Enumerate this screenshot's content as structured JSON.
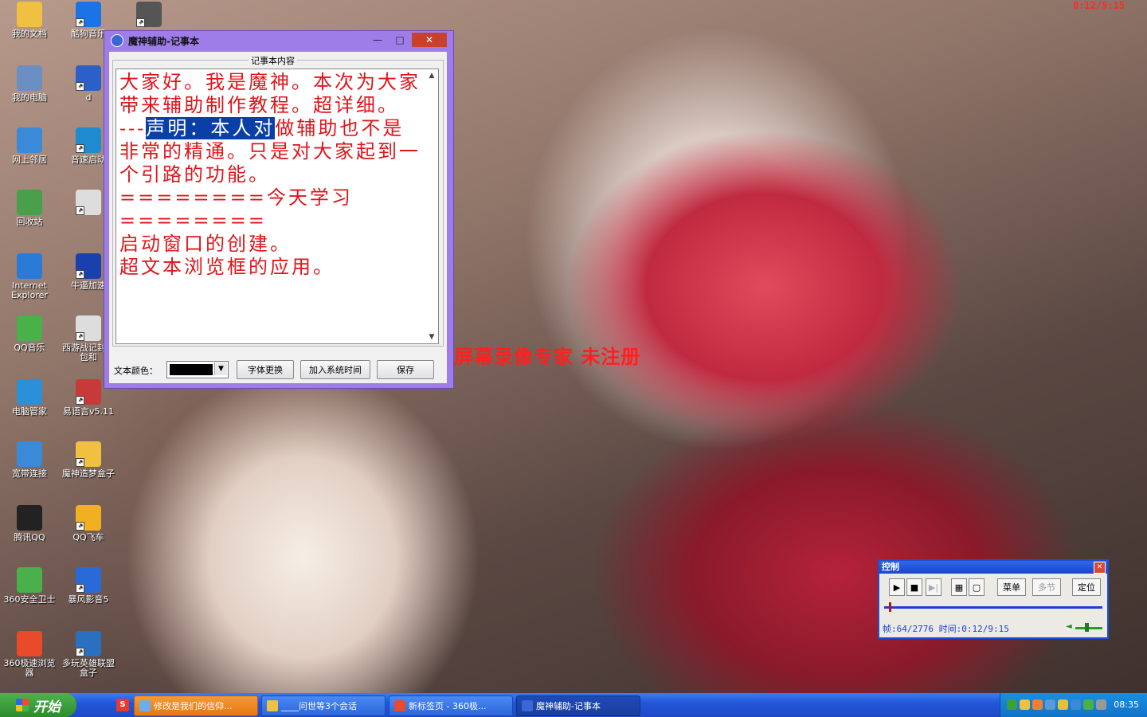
{
  "recorder_timer": "0:12/9:15",
  "desktop_icons": [
    {
      "label": "我的文档",
      "icon": "folder-documents-icon",
      "color": "#f0c040"
    },
    {
      "label": "酷狗音乐",
      "icon": "kugou-music-icon",
      "color": "#1a74e8"
    },
    {
      "label": "",
      "icon": "video-camera-icon",
      "color": "#555555"
    },
    {
      "label": "我的电脑",
      "icon": "my-computer-icon",
      "color": "#6a8fc0"
    },
    {
      "label": "d",
      "icon": "app-shortcut-icon",
      "color": "#2a60c8"
    },
    {
      "label": "网上邻居",
      "icon": "network-places-icon",
      "color": "#3a8ad8"
    },
    {
      "label": "音速启动",
      "icon": "quick-launch-icon",
      "color": "#1e8ad0"
    },
    {
      "label": "回收站",
      "icon": "recycle-bin-icon",
      "color": "#4aa04a"
    },
    {
      "label": "",
      "icon": "text-file-icon",
      "color": "#dddddd"
    },
    {
      "label": "Internet Explorer",
      "icon": "internet-explorer-icon",
      "color": "#2a7ad8"
    },
    {
      "label": "牛逼加速",
      "icon": "accelerator-icon",
      "color": "#1a40b0"
    },
    {
      "label": "QQ音乐",
      "icon": "qq-music-icon",
      "color": "#4ab04a"
    },
    {
      "label": "西游战记封背包和",
      "icon": "text-file-icon",
      "color": "#dddddd"
    },
    {
      "label": "电脑管家",
      "icon": "pc-manager-icon",
      "color": "#2a90d8"
    },
    {
      "label": "易语言v5.11",
      "icon": "e-language-icon",
      "color": "#c83a3a"
    },
    {
      "label": "宽带连接",
      "icon": "broadband-connection-icon",
      "color": "#3a8ad8"
    },
    {
      "label": "魔神造梦盒子",
      "icon": "folder-icon",
      "color": "#f0c040"
    },
    {
      "label": "腾讯QQ",
      "icon": "qq-penguin-icon",
      "color": "#222222"
    },
    {
      "label": "QQ飞车",
      "icon": "qq-speed-icon",
      "color": "#f0b020"
    },
    {
      "label": "360安全卫士",
      "icon": "360-safe-icon",
      "color": "#4ab04a"
    },
    {
      "label": "暴风影音5",
      "icon": "baofeng-player-icon",
      "color": "#2a6ad8"
    },
    {
      "label": "360极速浏览器",
      "icon": "360-browser-icon",
      "color": "#e84a2a"
    },
    {
      "label": "多玩英雄联盟盒子",
      "icon": "lol-box-icon",
      "color": "#2a70c0"
    }
  ],
  "notepad": {
    "title": "魔神辅助-记事本",
    "group_title": "记事本内容",
    "text_before": "大家好。我是魔神。本次为大家带来辅助制作教程。超详细。\n---",
    "text_selected": "声明：本人对",
    "text_after": "做辅助也不是非常的精通。只是对大家起到一个引路的功能。\n========今天学习========\n启动窗口的创建。\n超文本浏览框的应用。",
    "text_color_label": "文本颜色：",
    "text_color_value": "#000000",
    "btn_font": "字体更换",
    "btn_time": "加入系统时间",
    "btn_save": "保存"
  },
  "watermark": "屏幕录像专家  未注册",
  "control_panel": {
    "title": "控制",
    "btn_menu": "菜单",
    "btn_multi": "多节",
    "btn_locate": "定位",
    "frame_info": "帧:64/2776 时间:0:12/9:15",
    "frame_current": 64,
    "frame_total": 2776,
    "volume_level": 0.4
  },
  "taskbar": {
    "start_label": "开始",
    "tasks": [
      {
        "label": "修改是我们的信仰...",
        "style": "orange",
        "icon_color": "#6ab0e8"
      },
      {
        "label": "____问世等3个会话",
        "style": "blue",
        "icon_color": "#f0c040"
      },
      {
        "label": "新标签页 - 360极...",
        "style": "blue",
        "icon_color": "#e84a2a"
      },
      {
        "label": "魔神辅助-记事本",
        "style": "active",
        "icon_color": "#3a66d6"
      }
    ],
    "clock": "08:35"
  }
}
